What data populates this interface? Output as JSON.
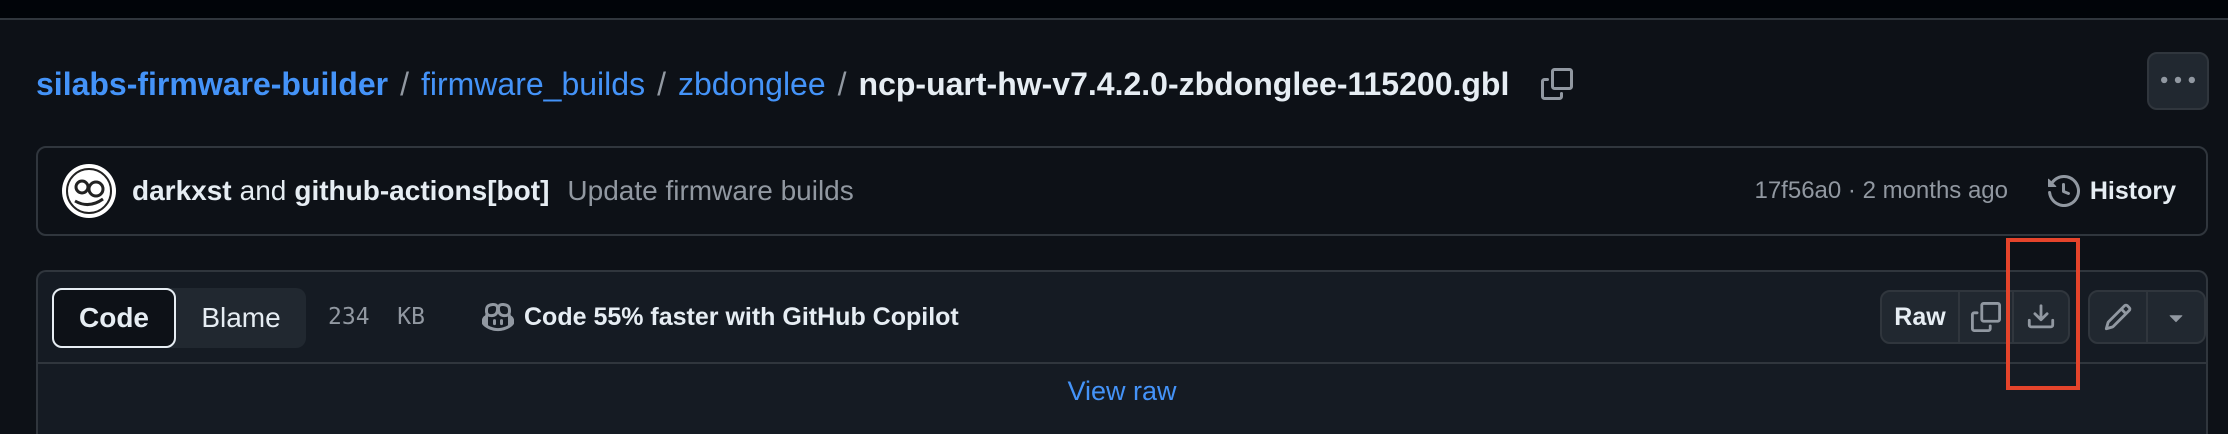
{
  "breadcrumb": {
    "repo": "silabs-firmware-builder",
    "folder1": "firmware_builds",
    "folder2": "zbdonglee",
    "separator": "/",
    "file": "ncp-uart-hw-v7.4.2.0-zbdonglee-115200.gbl"
  },
  "commit": {
    "author1": "darkxst",
    "and_text": "and",
    "author2": "github-actions[bot]",
    "message": "Update firmware builds",
    "meta": "17f56a0 · 2 months ago",
    "history_label": "History"
  },
  "file": {
    "tab_code": "Code",
    "tab_blame": "Blame",
    "size": "234  KB",
    "copilot_text": "Code 55% faster with GitHub Copilot",
    "raw_label": "Raw",
    "view_raw": "View raw"
  },
  "icons": {
    "copy_path": "copy-icon",
    "kebab": "kebab-horizontal-icon",
    "history": "history-icon",
    "copilot": "copilot-icon",
    "copy_raw": "copy-icon",
    "download": "download-icon",
    "edit": "pencil-icon",
    "more": "triangle-down-icon"
  },
  "colors": {
    "background": "#0d1117",
    "link": "#4493f8",
    "border": "#30363d",
    "highlight": "#e5442b"
  }
}
